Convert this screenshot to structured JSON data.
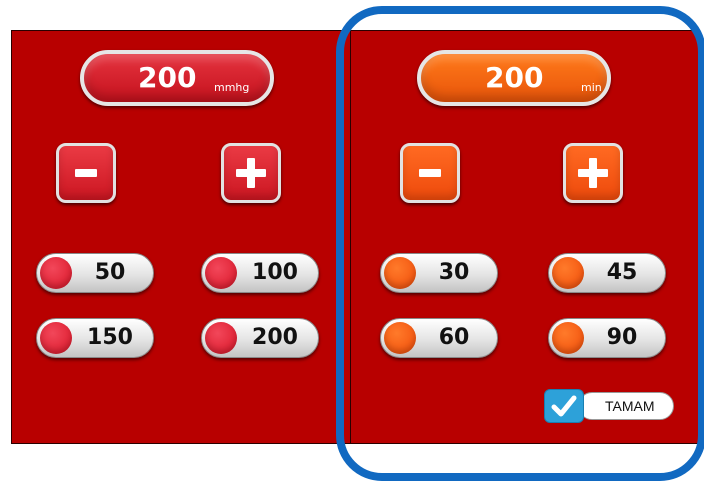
{
  "pressure": {
    "value": "200",
    "unit": "mmhg",
    "minus_label": "minus",
    "plus_label": "plus",
    "presets": [
      {
        "label": "50"
      },
      {
        "label": "100"
      },
      {
        "label": "150"
      },
      {
        "label": "200"
      }
    ]
  },
  "duration": {
    "value": "200",
    "unit": "min",
    "presets": [
      {
        "label": "30"
      },
      {
        "label": "45"
      },
      {
        "label": "60"
      },
      {
        "label": "90"
      }
    ]
  },
  "confirm": {
    "label": "TAMAM",
    "checked": true
  },
  "colors": {
    "panel": "#b80000",
    "pressure_accent": "#d91426",
    "duration_accent": "#f04b08",
    "highlight": "#1169c1",
    "check": "#2da1d9"
  }
}
